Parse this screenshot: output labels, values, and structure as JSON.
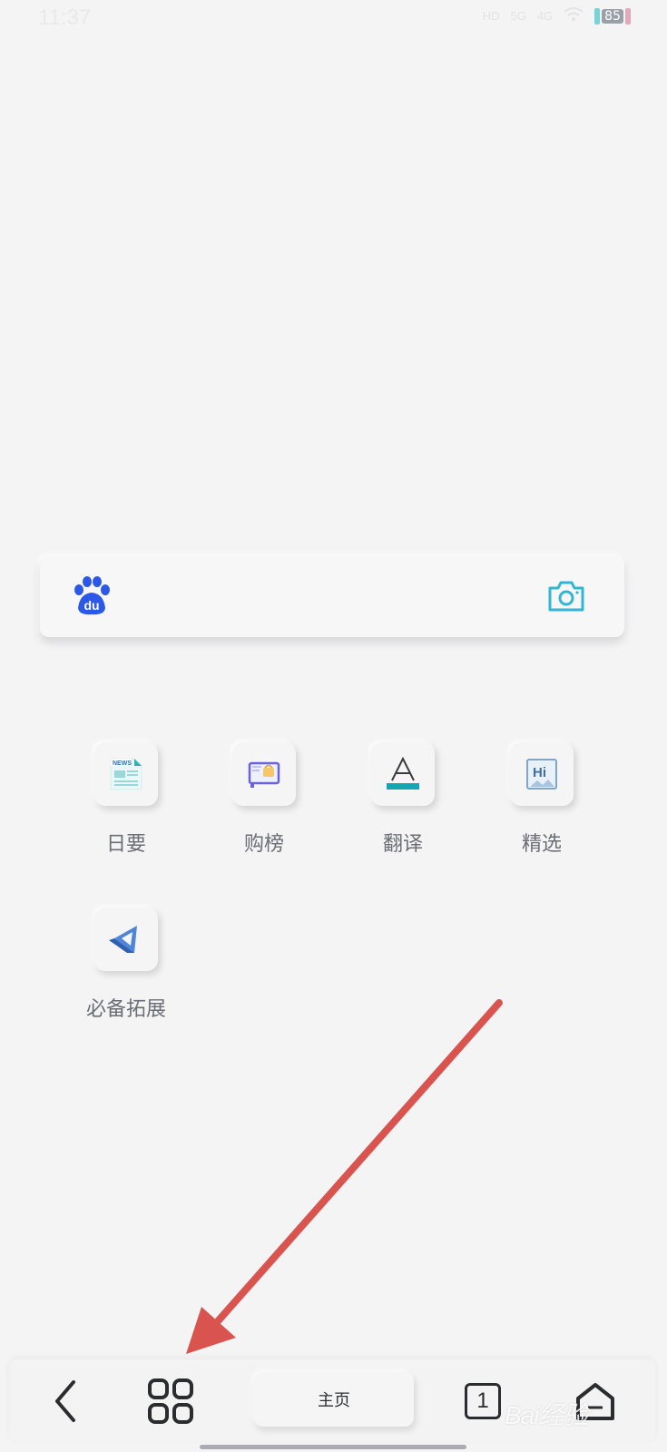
{
  "status_bar": {
    "time": "11:37",
    "network_1": "HD",
    "network_2": "5G",
    "network_3": "4G",
    "battery": "85"
  },
  "search": {
    "logo_text": "du",
    "colors": {
      "baidu_blue": "#2b58e6",
      "camera_teal": "#34b6d3"
    }
  },
  "shortcuts": [
    {
      "label": "日要",
      "icon": "news-icon"
    },
    {
      "label": "购榜",
      "icon": "shopping-board-icon"
    },
    {
      "label": "翻译",
      "icon": "translate-icon"
    },
    {
      "label": "精选",
      "icon": "hi-picture-icon"
    },
    {
      "label": "必备拓展",
      "icon": "extension-icon"
    }
  ],
  "bottom_bar": {
    "home_label": "主页",
    "tabs_count": "1"
  },
  "annotation": {
    "arrow_color": "#d9534f"
  },
  "watermark": "Bai经验"
}
